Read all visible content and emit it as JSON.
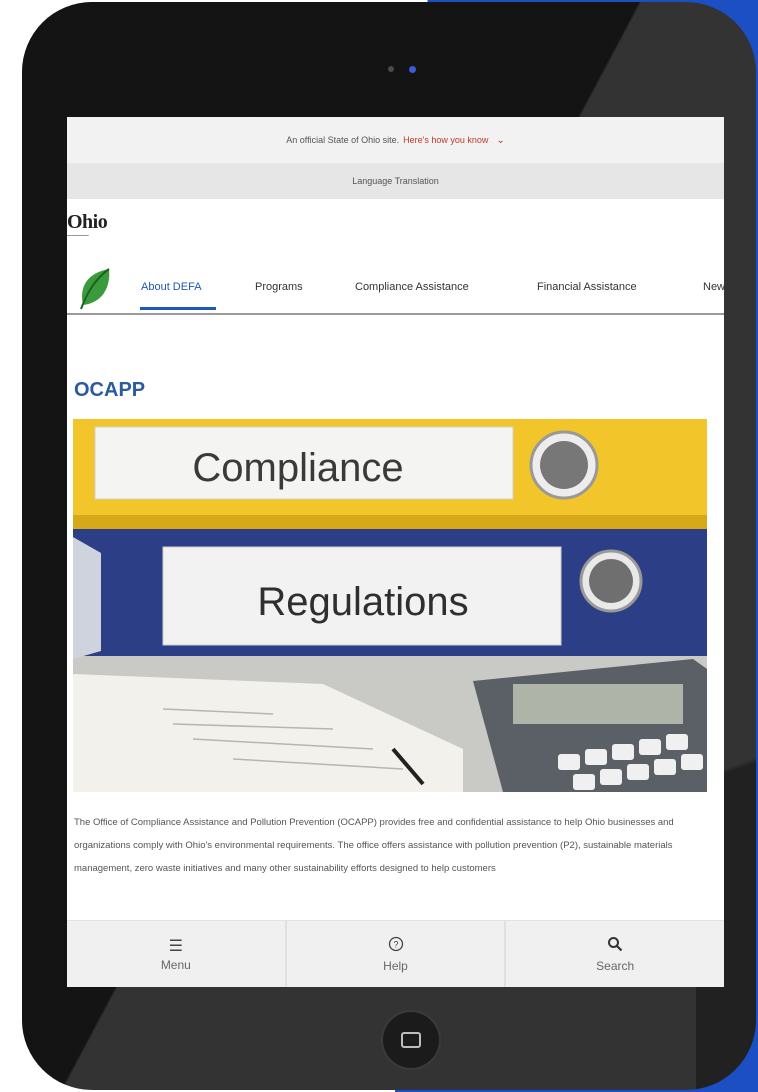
{
  "banner": {
    "official_text": "An official State of Ohio site.",
    "link_text": "Here's how you know",
    "chevron": "chevron-down-icon"
  },
  "language": {
    "label": "Language Translation"
  },
  "logo": {
    "word": "Ohio"
  },
  "nav": {
    "items": [
      {
        "label": "About DEFA",
        "active": true
      },
      {
        "label": "Programs",
        "active": false
      },
      {
        "label": "Compliance Assistance",
        "active": false
      },
      {
        "label": "Financial Assistance",
        "active": false
      },
      {
        "label": "New",
        "active": false
      }
    ]
  },
  "page": {
    "title": "OCAPP",
    "hero": {
      "binder_top": "Compliance",
      "binder_bottom": "Regulations"
    },
    "body": "The Office of Compliance Assistance and Pollution Prevention (OCAPP) provides free and confidential assistance to help Ohio businesses and organizations comply with Ohio's environmental requirements. The office offers assistance with pollution prevention (P2), sustainable materials management, zero waste initiatives and many other sustainability efforts designed to help customers"
  },
  "bottom_bar": {
    "items": [
      {
        "label": "Menu",
        "icon": "menu-icon"
      },
      {
        "label": "Help",
        "icon": "help-icon"
      },
      {
        "label": "Search",
        "icon": "search-icon"
      }
    ]
  },
  "colors": {
    "accent": "#1f57b8",
    "title": "#2c5aa0",
    "link": "#c0392b",
    "backdrop": "#1c4fc4"
  }
}
